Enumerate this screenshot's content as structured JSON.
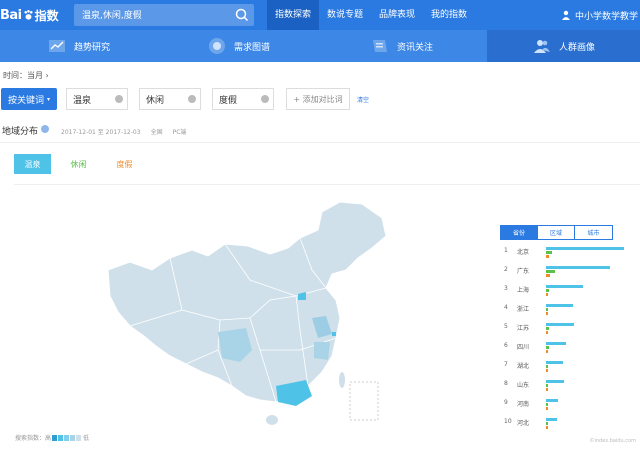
{
  "header": {
    "logo_text": "Bai",
    "logo_suffix": "指数",
    "search_query": "温泉,休闲,度假",
    "nav": [
      "指数探索",
      "数说专题",
      "品牌表现",
      "我的指数"
    ],
    "active_nav": 0,
    "user_name": "中小学数学教学"
  },
  "subnav": {
    "tabs": [
      "趋势研究",
      "需求图谱",
      "资讯关注",
      "人群画像"
    ],
    "active_tab": 3
  },
  "filters": {
    "time_label": "时间：当月",
    "keyword_button": "按关键词",
    "keywords": [
      "温泉",
      "休闲",
      "度假"
    ],
    "add_compare": "+ 添加对比词",
    "clear": "清空"
  },
  "region": {
    "title": "地域分布",
    "date_range": "2017-12-01 至 2017-12-03",
    "scope": "全国",
    "device": "PC端",
    "series_tabs": [
      "温泉",
      "休闲",
      "度假"
    ],
    "legend_low": "搜索指数：高",
    "legend_high": "低",
    "colors": {
      "accent": "#2a7ae2",
      "series1": "#4fc2e8",
      "series2": "#5cc14a",
      "series3": "#f08a2a",
      "map_base": "#cfe0ea"
    }
  },
  "ranking": {
    "tabs": [
      "省份",
      "区域",
      "城市"
    ],
    "active_tab": 0,
    "rows": [
      {
        "rank": "1",
        "name": "北京",
        "v1": 1.0,
        "v2": 0.08,
        "v3": 0.04
      },
      {
        "rank": "2",
        "name": "广东",
        "v1": 0.82,
        "v2": 0.12,
        "v3": 0.05
      },
      {
        "rank": "3",
        "name": "上海",
        "v1": 0.47,
        "v2": 0.04,
        "v3": 0.03
      },
      {
        "rank": "4",
        "name": "浙江",
        "v1": 0.35,
        "v2": 0.03,
        "v3": 0.03
      },
      {
        "rank": "5",
        "name": "江苏",
        "v1": 0.36,
        "v2": 0.04,
        "v3": 0.03
      },
      {
        "rank": "6",
        "name": "四川",
        "v1": 0.25,
        "v2": 0.04,
        "v3": 0.03
      },
      {
        "rank": "7",
        "name": "湖北",
        "v1": 0.22,
        "v2": 0.03,
        "v3": 0.03
      },
      {
        "rank": "8",
        "name": "山东",
        "v1": 0.23,
        "v2": 0.03,
        "v3": 0.03
      },
      {
        "rank": "9",
        "name": "河南",
        "v1": 0.16,
        "v2": 0.03,
        "v3": 0.03
      },
      {
        "rank": "10",
        "name": "河北",
        "v1": 0.14,
        "v2": 0.03,
        "v3": 0.03
      }
    ]
  },
  "footer": {
    "watermark": "©index.baidu.com"
  }
}
